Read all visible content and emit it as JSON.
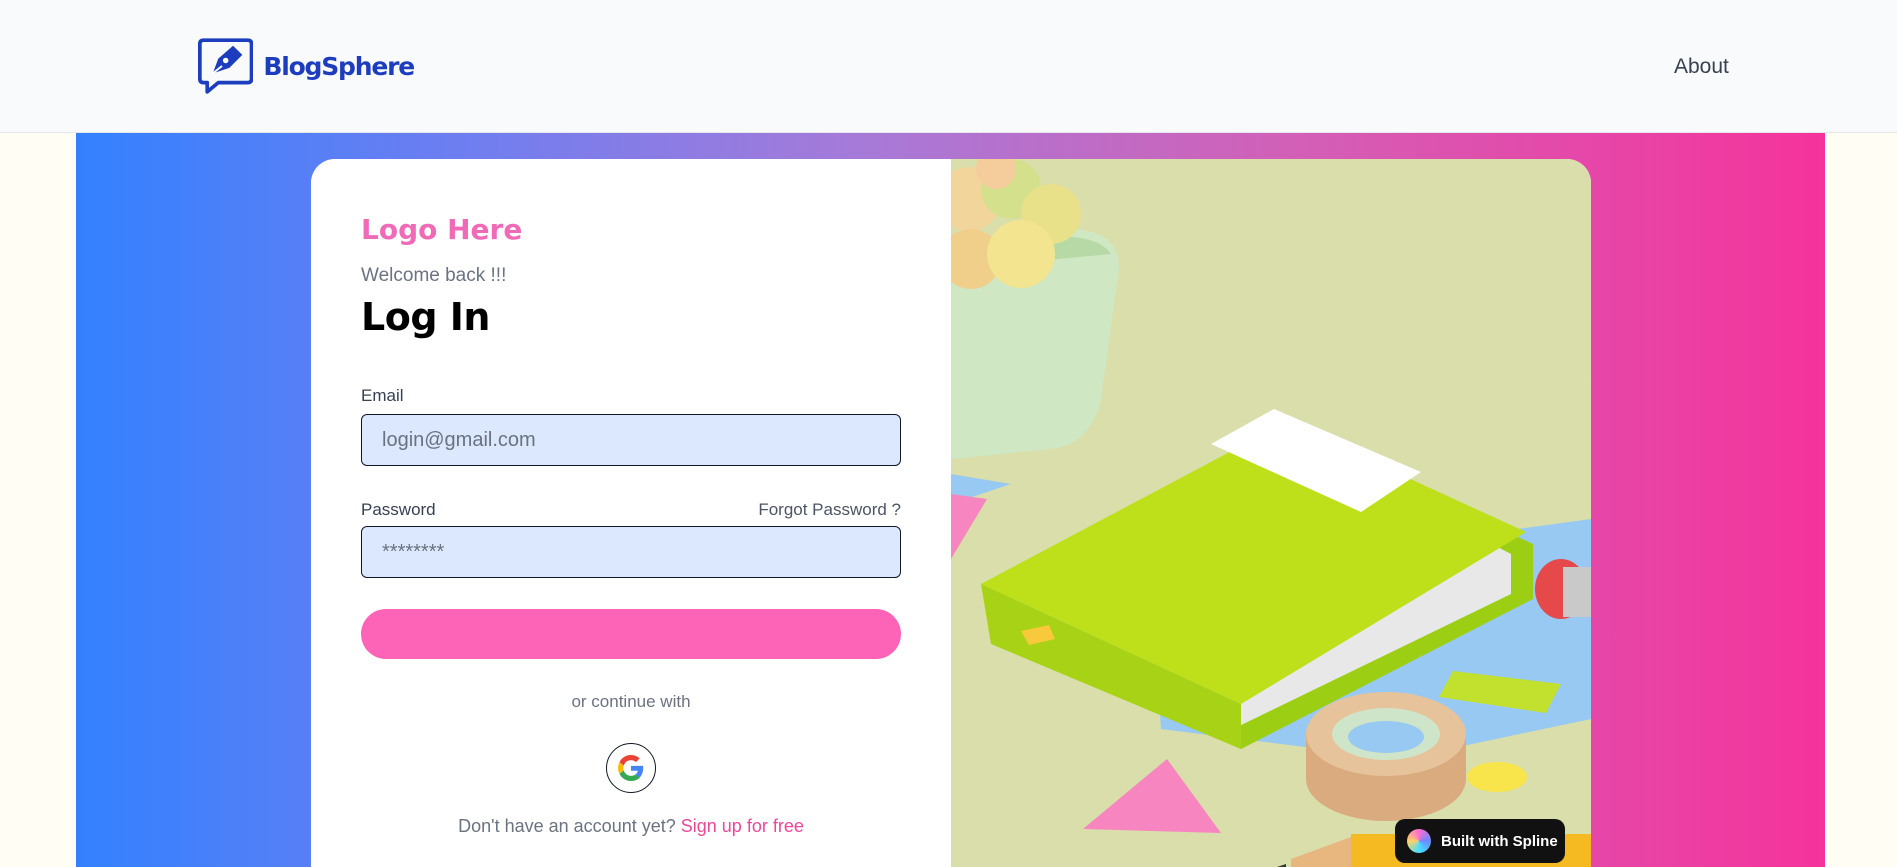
{
  "header": {
    "brand_name": "BlogSphere",
    "about_label": "About"
  },
  "login": {
    "logo_text": "Logo Here",
    "welcome": "Welcome back !!!",
    "title": "Log In",
    "email_label": "Email",
    "email_placeholder": "login@gmail.com",
    "password_label": "Password",
    "password_placeholder": "********",
    "forgot_password": "Forgot Password ?",
    "continue_text": "or continue with",
    "signup_prompt": "Don't have an account yet?",
    "signup_link": "Sign up for free"
  },
  "badge": {
    "label": "Built with Spline"
  },
  "colors": {
    "brand_blue": "#1d3dbf",
    "accent_pink": "#fd63b6",
    "input_bg": "#dbe8fd",
    "gradient_start": "#3381ff",
    "gradient_end": "#f5339c"
  }
}
